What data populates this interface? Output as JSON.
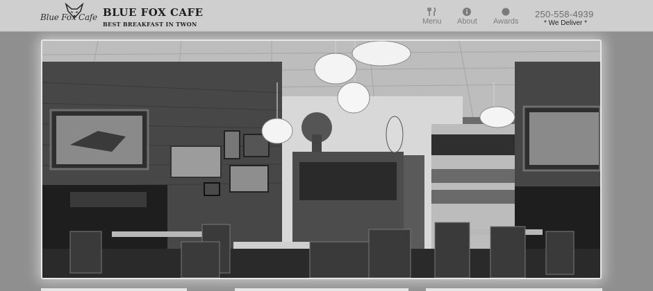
{
  "brand": {
    "logo_text": "Blue Fox Cafe",
    "title": "BLUE FOX CAFE",
    "tagline": "BEST BREAKFAST IN TWON"
  },
  "nav": [
    {
      "label": "Menu",
      "icon": "utensils-icon"
    },
    {
      "label": "About",
      "icon": "info-icon"
    },
    {
      "label": "Awards",
      "icon": "award-icon"
    }
  ],
  "contact": {
    "phone": "250-558-4939",
    "delivery_note": "* We Deliver *"
  },
  "hero": {
    "description_icon": "cafe-interior-photo"
  }
}
